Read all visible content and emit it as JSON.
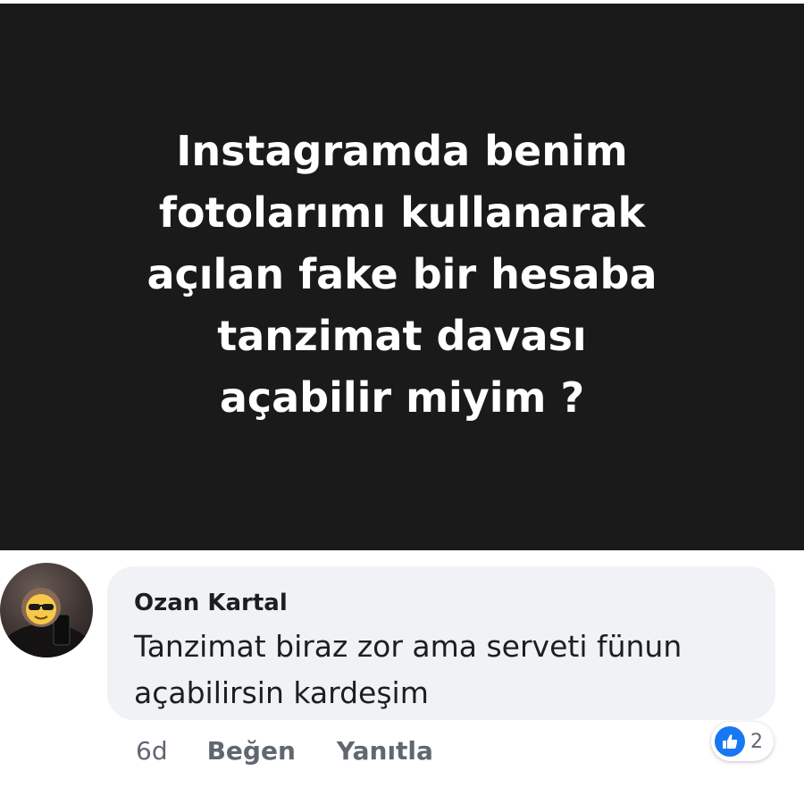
{
  "post": {
    "text": "Instagramda benim\nfotolarımı kullanarak\naçılan fake bir hesaba\ntanzimat davası\naçabilir miyim ?"
  },
  "comment": {
    "author": "Ozan Kartal",
    "text": "Tanzimat biraz zor ama serveti fünun\naçabilirsin kardeşim",
    "timestamp": "6d",
    "like_label": "Beğen",
    "reply_label": "Yanıtla",
    "reaction_count": "2",
    "reaction_icon": "thumbs-up-icon",
    "avatar_icon": "user-avatar-with-sunglasses-emoji"
  },
  "colors": {
    "post_background": "#1a1a1a",
    "post_text": "#ffffff",
    "bubble_background": "#f0f2f5",
    "meta_text": "#606770",
    "reaction_blue": "#1877f2"
  }
}
